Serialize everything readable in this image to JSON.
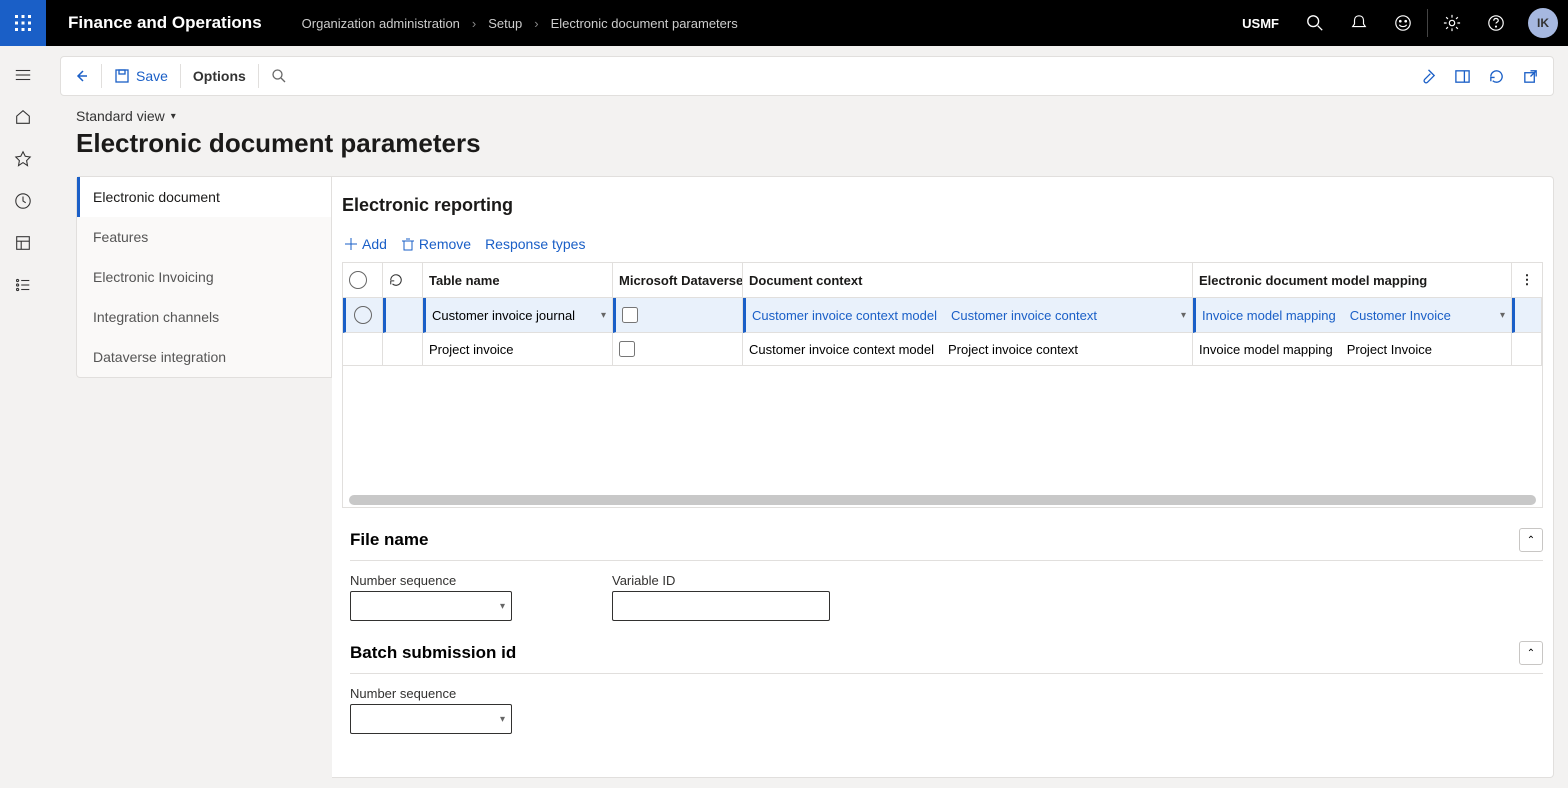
{
  "header": {
    "app_title": "Finance and Operations",
    "breadcrumbs": [
      "Organization administration",
      "Setup",
      "Electronic document parameters"
    ],
    "company": "USMF",
    "avatar": "IK"
  },
  "actionbar": {
    "save": "Save",
    "options": "Options"
  },
  "page": {
    "std_view": "Standard view",
    "title": "Electronic document parameters"
  },
  "vnav": [
    "Electronic document",
    "Features",
    "Electronic Invoicing",
    "Integration channels",
    "Dataverse integration"
  ],
  "section": {
    "title": "Electronic reporting",
    "actions": {
      "add": "Add",
      "remove": "Remove",
      "response": "Response types"
    },
    "columns": {
      "table": "Table name",
      "dataverse": "Microsoft Dataverse ...",
      "context": "Document context",
      "mapping": "Electronic document model mapping"
    },
    "rows": [
      {
        "table": "Customer invoice journal",
        "ctx_a": "Customer invoice context model",
        "ctx_b": "Customer invoice context",
        "map_a": "Invoice model mapping",
        "map_b": "Customer Invoice"
      },
      {
        "table": "Project invoice",
        "ctx_a": "Customer invoice context model",
        "ctx_b": "Project invoice context",
        "map_a": "Invoice model mapping",
        "map_b": "Project Invoice"
      }
    ]
  },
  "file_name": {
    "heading": "File name",
    "num_seq": "Number sequence",
    "var_id": "Variable ID"
  },
  "batch": {
    "heading": "Batch submission id",
    "num_seq": "Number sequence"
  }
}
